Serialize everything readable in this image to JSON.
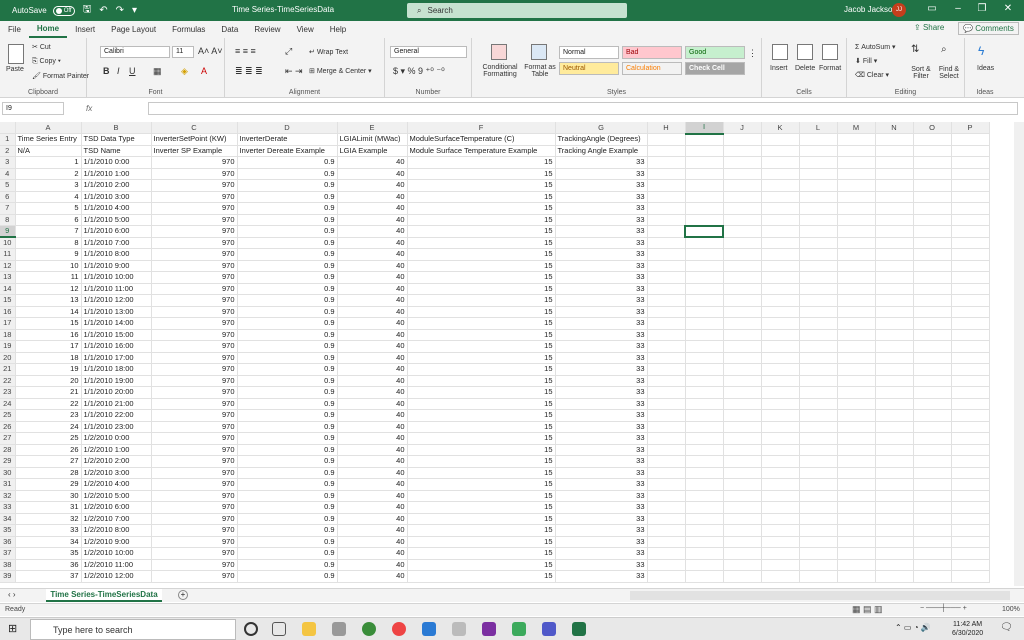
{
  "titlebar": {
    "autosave_label": "AutoSave",
    "autosave_state": "Off",
    "title": "Time Series-TimeSeriesData",
    "search_placeholder": "Search",
    "user_name": "Jacob Jackson",
    "user_initials": "JJ"
  },
  "menu": {
    "tabs": [
      "File",
      "Home",
      "Insert",
      "Page Layout",
      "Formulas",
      "Data",
      "Review",
      "View",
      "Help"
    ],
    "active": "Home",
    "share": "Share",
    "comments": "Comments"
  },
  "ribbon": {
    "clipboard": {
      "paste": "Paste",
      "cut": "Cut",
      "copy": "Copy",
      "format_painter": "Format Painter",
      "label": "Clipboard"
    },
    "font": {
      "name": "Calibri",
      "size": "11",
      "label": "Font"
    },
    "alignment": {
      "wrap": "Wrap Text",
      "merge": "Merge & Center",
      "label": "Alignment"
    },
    "number": {
      "format": "General",
      "label": "Number"
    },
    "styles": {
      "conditional": "Conditional Formatting",
      "format_table": "Format as Table",
      "normal": "Normal",
      "bad": "Bad",
      "good": "Good",
      "neutral": "Neutral",
      "calculation": "Calculation",
      "check_cell": "Check Cell",
      "label": "Styles"
    },
    "cells": {
      "insert": "Insert",
      "delete": "Delete",
      "format": "Format",
      "label": "Cells"
    },
    "editing": {
      "autosum": "AutoSum",
      "fill": "Fill",
      "clear": "Clear",
      "sort": "Sort & Filter",
      "find": "Find & Select",
      "label": "Editing"
    },
    "ideas": {
      "ideas": "Ideas",
      "label": "Ideas"
    }
  },
  "formula_bar": {
    "name_box": "I9",
    "fx": "fx",
    "formula": ""
  },
  "grid": {
    "columns": [
      "A",
      "B",
      "C",
      "D",
      "E",
      "F",
      "G",
      "H",
      "I",
      "J",
      "K",
      "L",
      "M",
      "N",
      "O",
      "P"
    ],
    "selected_col": "I",
    "selected_row": "9",
    "header_row": [
      "Time Series Entry",
      "TSD Data Type",
      "InverterSetPoint (KW)",
      "InverterDerate",
      "LGIALimit (MWac)",
      "ModuleSurfaceTemperature (C)",
      "TrackingAngle (Degrees)"
    ],
    "name_row": [
      "N/A",
      "TSD Name",
      "Inverter SP Example",
      "Inverter Dereate Example",
      "LGIA Example",
      "Module Surface Temperature Example",
      "Tracking Angle Example"
    ],
    "data_rows": [
      [
        "1",
        "1/1/2010 0:00",
        "970",
        "0.9",
        "40",
        "15",
        "33"
      ],
      [
        "2",
        "1/1/2010 1:00",
        "970",
        "0.9",
        "40",
        "15",
        "33"
      ],
      [
        "3",
        "1/1/2010 2:00",
        "970",
        "0.9",
        "40",
        "15",
        "33"
      ],
      [
        "4",
        "1/1/2010 3:00",
        "970",
        "0.9",
        "40",
        "15",
        "33"
      ],
      [
        "5",
        "1/1/2010 4:00",
        "970",
        "0.9",
        "40",
        "15",
        "33"
      ],
      [
        "6",
        "1/1/2010 5:00",
        "970",
        "0.9",
        "40",
        "15",
        "33"
      ],
      [
        "7",
        "1/1/2010 6:00",
        "970",
        "0.9",
        "40",
        "15",
        "33"
      ],
      [
        "8",
        "1/1/2010 7:00",
        "970",
        "0.9",
        "40",
        "15",
        "33"
      ],
      [
        "9",
        "1/1/2010 8:00",
        "970",
        "0.9",
        "40",
        "15",
        "33"
      ],
      [
        "10",
        "1/1/2010 9:00",
        "970",
        "0.9",
        "40",
        "15",
        "33"
      ],
      [
        "11",
        "1/1/2010 10:00",
        "970",
        "0.9",
        "40",
        "15",
        "33"
      ],
      [
        "12",
        "1/1/2010 11:00",
        "970",
        "0.9",
        "40",
        "15",
        "33"
      ],
      [
        "13",
        "1/1/2010 12:00",
        "970",
        "0.9",
        "40",
        "15",
        "33"
      ],
      [
        "14",
        "1/1/2010 13:00",
        "970",
        "0.9",
        "40",
        "15",
        "33"
      ],
      [
        "15",
        "1/1/2010 14:00",
        "970",
        "0.9",
        "40",
        "15",
        "33"
      ],
      [
        "16",
        "1/1/2010 15:00",
        "970",
        "0.9",
        "40",
        "15",
        "33"
      ],
      [
        "17",
        "1/1/2010 16:00",
        "970",
        "0.9",
        "40",
        "15",
        "33"
      ],
      [
        "18",
        "1/1/2010 17:00",
        "970",
        "0.9",
        "40",
        "15",
        "33"
      ],
      [
        "19",
        "1/1/2010 18:00",
        "970",
        "0.9",
        "40",
        "15",
        "33"
      ],
      [
        "20",
        "1/1/2010 19:00",
        "970",
        "0.9",
        "40",
        "15",
        "33"
      ],
      [
        "21",
        "1/1/2010 20:00",
        "970",
        "0.9",
        "40",
        "15",
        "33"
      ],
      [
        "22",
        "1/1/2010 21:00",
        "970",
        "0.9",
        "40",
        "15",
        "33"
      ],
      [
        "23",
        "1/1/2010 22:00",
        "970",
        "0.9",
        "40",
        "15",
        "33"
      ],
      [
        "24",
        "1/1/2010 23:00",
        "970",
        "0.9",
        "40",
        "15",
        "33"
      ],
      [
        "25",
        "1/2/2010 0:00",
        "970",
        "0.9",
        "40",
        "15",
        "33"
      ],
      [
        "26",
        "1/2/2010 1:00",
        "970",
        "0.9",
        "40",
        "15",
        "33"
      ],
      [
        "27",
        "1/2/2010 2:00",
        "970",
        "0.9",
        "40",
        "15",
        "33"
      ],
      [
        "28",
        "1/2/2010 3:00",
        "970",
        "0.9",
        "40",
        "15",
        "33"
      ],
      [
        "29",
        "1/2/2010 4:00",
        "970",
        "0.9",
        "40",
        "15",
        "33"
      ],
      [
        "30",
        "1/2/2010 5:00",
        "970",
        "0.9",
        "40",
        "15",
        "33"
      ],
      [
        "31",
        "1/2/2010 6:00",
        "970",
        "0.9",
        "40",
        "15",
        "33"
      ],
      [
        "32",
        "1/2/2010 7:00",
        "970",
        "0.9",
        "40",
        "15",
        "33"
      ],
      [
        "33",
        "1/2/2010 8:00",
        "970",
        "0.9",
        "40",
        "15",
        "33"
      ],
      [
        "34",
        "1/2/2010 9:00",
        "970",
        "0.9",
        "40",
        "15",
        "33"
      ],
      [
        "35",
        "1/2/2010 10:00",
        "970",
        "0.9",
        "40",
        "15",
        "33"
      ],
      [
        "36",
        "1/2/2010 11:00",
        "970",
        "0.9",
        "40",
        "15",
        "33"
      ],
      [
        "37",
        "1/2/2010 12:00",
        "970",
        "0.9",
        "40",
        "15",
        "33"
      ]
    ]
  },
  "sheet": {
    "tab": "Time Series-TimeSeriesData"
  },
  "status": {
    "left": "Ready",
    "zoom": "100%"
  },
  "taskbar": {
    "search_placeholder": "Type here to search",
    "time": "11:42 AM",
    "date": "6/30/2020"
  },
  "colors": {
    "accent": "#217346",
    "bad_bg": "#ffc7ce",
    "good_bg": "#c6efce",
    "neutral_bg": "#ffeb9c",
    "check_bg": "#a5a5a5"
  }
}
